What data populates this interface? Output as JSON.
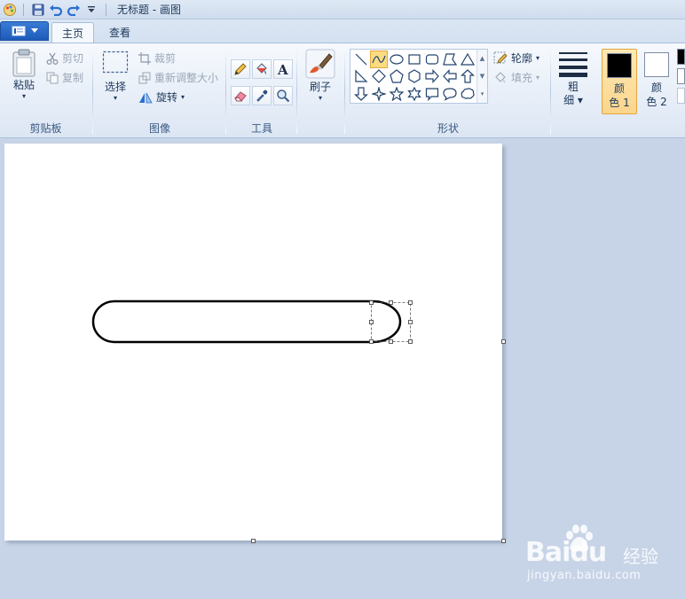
{
  "window": {
    "title": "无标题 - 画图"
  },
  "tabs": [
    {
      "label": "主页",
      "active": true
    },
    {
      "label": "查看",
      "active": false
    }
  ],
  "ribbon": {
    "clipboard": {
      "label": "剪贴板",
      "paste": "粘贴",
      "cut": "剪切",
      "copy": "复制"
    },
    "image": {
      "label": "图像",
      "select": "选择",
      "crop": "裁剪",
      "resize": "重新调整大小",
      "rotate": "旋转"
    },
    "tools": {
      "label": "工具"
    },
    "brushes": {
      "label": "刷子"
    },
    "shapes": {
      "label": "形状",
      "outline": "轮廓",
      "fill": "填充"
    },
    "size": {
      "label_line1": "粗",
      "label_line2": "细"
    },
    "colors": {
      "color1": {
        "line1": "颜",
        "line2": "色 1",
        "value": "#000000"
      },
      "color2": {
        "line1": "颜",
        "line2": "色 2",
        "value": "#ffffff"
      }
    }
  },
  "watermark": {
    "brand": "Baidu",
    "brand_cn": "经验",
    "url": "jingyan.baidu.com"
  },
  "colors": {
    "accent": "#1d5bb8",
    "selection_highlight": "#fbdc83",
    "canvas": "#ffffff",
    "workspace": "#c7d4e7"
  }
}
